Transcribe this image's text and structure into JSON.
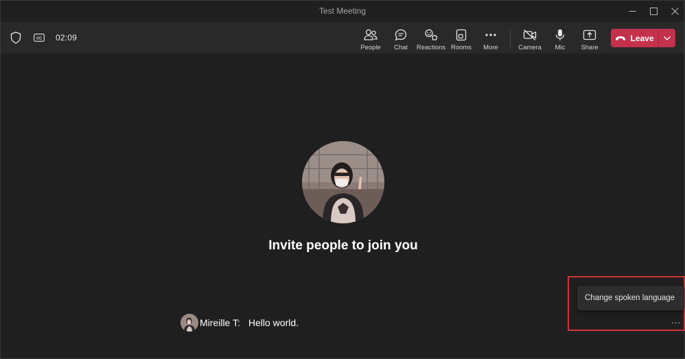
{
  "window": {
    "title": "Test Meeting"
  },
  "toolbar": {
    "timer": "02:09",
    "buttons": {
      "people": "People",
      "chat": "Chat",
      "reactions": "Reactions",
      "rooms": "Rooms",
      "more": "More",
      "camera": "Camera",
      "mic": "Mic",
      "share": "Share"
    },
    "leave_label": "Leave",
    "leave_color": "#c4314b"
  },
  "stage": {
    "invite_text": "Invite people to join you"
  },
  "caption": {
    "speaker": "Mireille T:",
    "text": "Hello world."
  },
  "caption_menu": {
    "item": "Change spoken language",
    "more": "..."
  },
  "colors": {
    "background": "#1f1f1f",
    "toolbar": "#292929",
    "highlight": "#d13438"
  }
}
